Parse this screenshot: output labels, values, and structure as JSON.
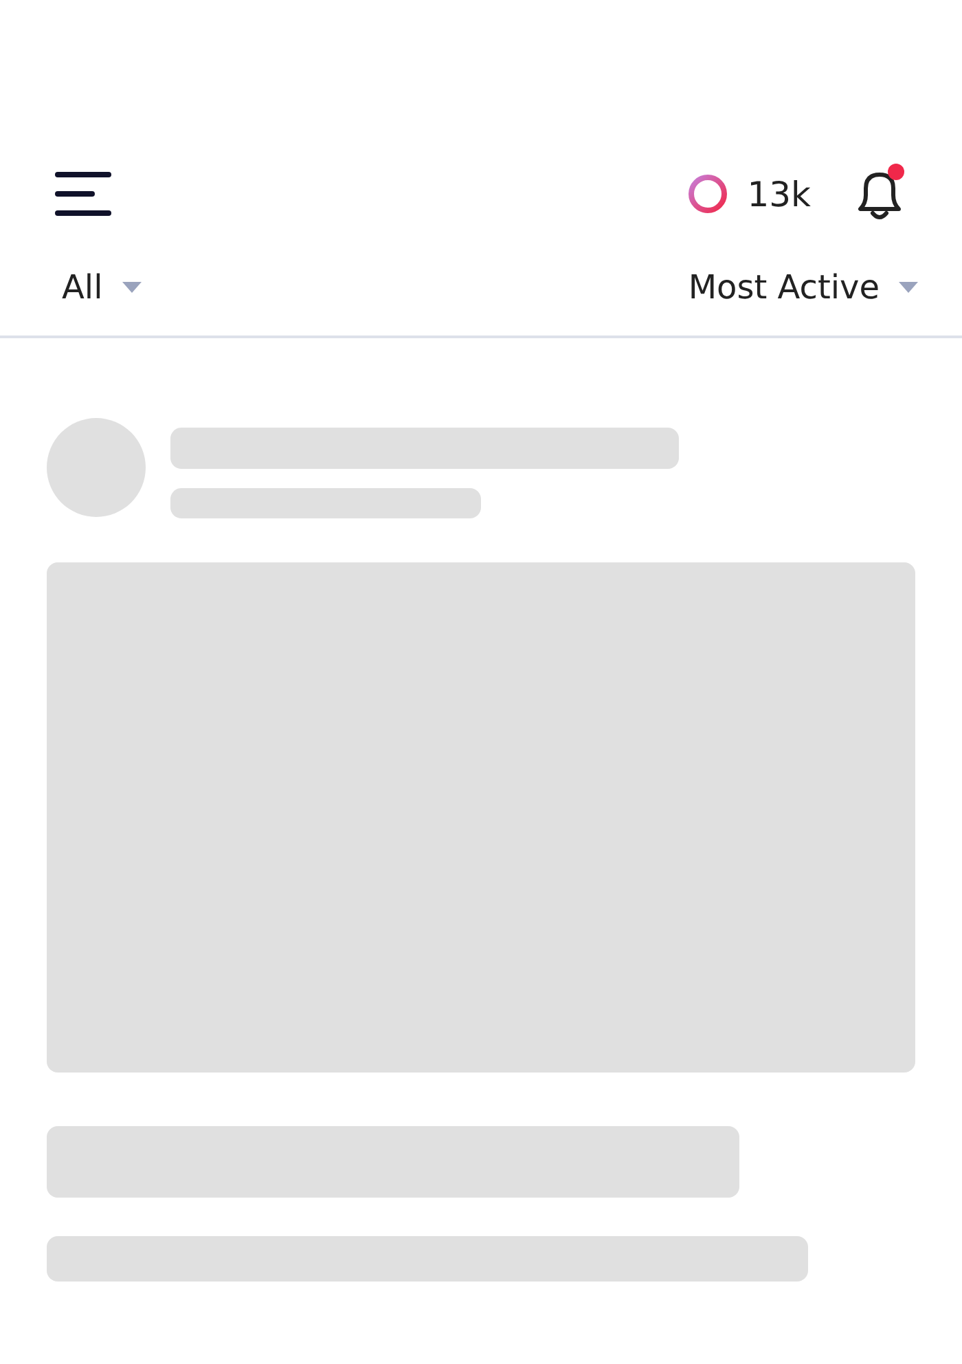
{
  "header": {
    "coins": "13k",
    "has_unread_notifications": true
  },
  "filters": [
    {
      "label": "All"
    },
    {
      "label": "Most Active"
    }
  ],
  "feed": {
    "loading": true
  }
}
